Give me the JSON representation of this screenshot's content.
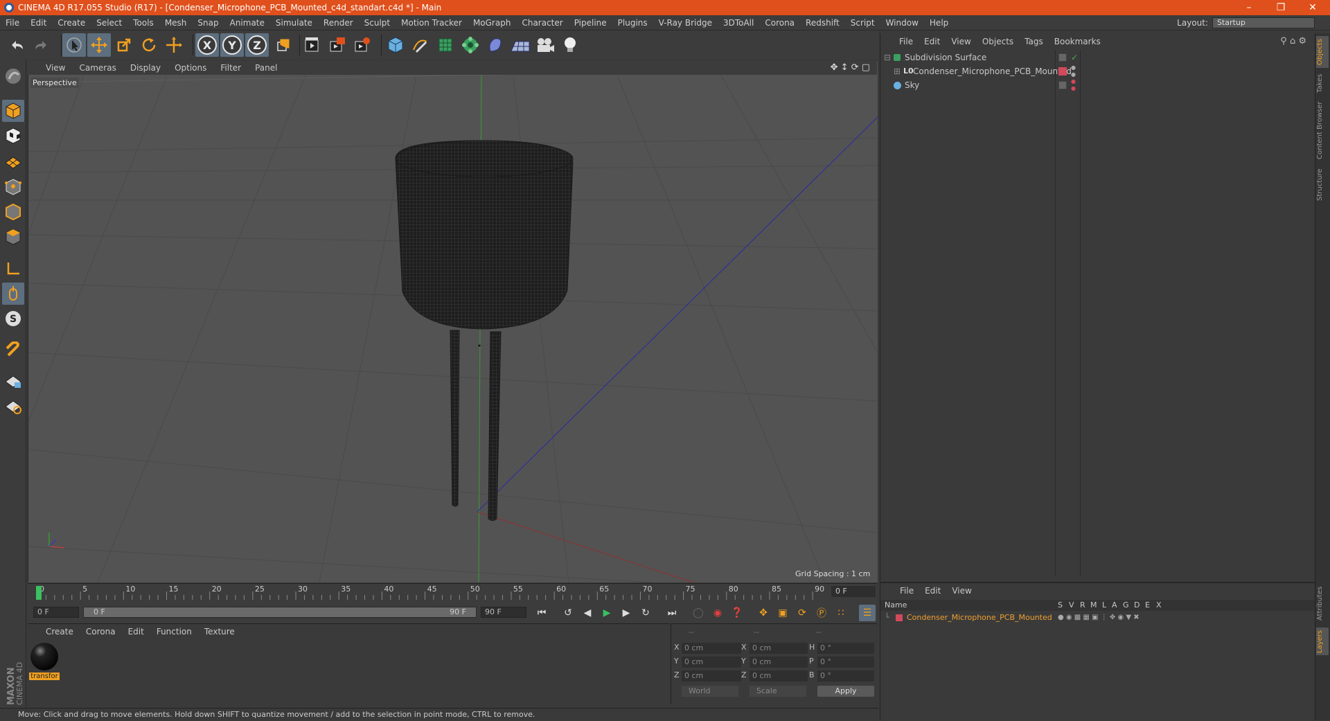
{
  "window": {
    "title": "CINEMA 4D R17.055 Studio (R17) - [Condenser_Microphone_PCB_Mounted_c4d_standart.c4d *] - Main"
  },
  "menubar": {
    "items": [
      "File",
      "Edit",
      "Create",
      "Select",
      "Tools",
      "Mesh",
      "Snap",
      "Animate",
      "Simulate",
      "Render",
      "Sculpt",
      "Motion Tracker",
      "MoGraph",
      "Character",
      "Pipeline",
      "Plugins",
      "V-Ray Bridge",
      "3DToAll",
      "Corona",
      "Redshift",
      "Script",
      "Window",
      "Help"
    ],
    "layout_label": "Layout:",
    "layout_value": "Startup"
  },
  "toolbar": {
    "axis_x": "X",
    "axis_y": "Y",
    "axis_z": "Z"
  },
  "viewport": {
    "menu": [
      "View",
      "Cameras",
      "Display",
      "Options",
      "Filter",
      "Panel"
    ],
    "camera_label": "Perspective",
    "grid_spacing": "Grid Spacing : 1 cm"
  },
  "timeline": {
    "ticks": [
      "0",
      "5",
      "10",
      "15",
      "20",
      "25",
      "30",
      "35",
      "40",
      "45",
      "50",
      "55",
      "60",
      "65",
      "70",
      "75",
      "80",
      "85",
      "90"
    ],
    "current_frame_field": "0 F",
    "start_field": "0 F",
    "range_start": "0 F",
    "range_end": "90 F",
    "end_field": "90 F"
  },
  "material_panel": {
    "menu": [
      "Create",
      "Corona",
      "Edit",
      "Function",
      "Texture"
    ],
    "material_name": "transfor"
  },
  "coords_panel": {
    "headers": [
      "--",
      "--",
      "--"
    ],
    "rows": [
      {
        "a": "X",
        "av": "0 cm",
        "b": "X",
        "bv": "0 cm",
        "c": "H",
        "cv": "0 °"
      },
      {
        "a": "Y",
        "av": "0 cm",
        "b": "Y",
        "bv": "0 cm",
        "c": "P",
        "cv": "0 °"
      },
      {
        "a": "Z",
        "av": "0 cm",
        "b": "Z",
        "bv": "0 cm",
        "c": "B",
        "cv": "0 °"
      }
    ],
    "world": "World",
    "scale": "Scale",
    "apply": "Apply"
  },
  "objects_panel": {
    "menu": [
      "File",
      "Edit",
      "View",
      "Objects",
      "Tags",
      "Bookmarks"
    ],
    "rows": [
      {
        "name": "Subdivision Surface"
      },
      {
        "name": "Condenser_Microphone_PCB_Mounted"
      },
      {
        "name": "Sky"
      }
    ]
  },
  "layers_panel": {
    "menu": [
      "File",
      "Edit",
      "View"
    ],
    "col_name": "Name",
    "cols": [
      "S",
      "V",
      "R",
      "M",
      "L",
      "A",
      "G",
      "D",
      "E",
      "X"
    ],
    "row_name": "Condenser_Microphone_PCB_Mounted"
  },
  "right_tabs": [
    "Objects",
    "Takes",
    "Content Browser",
    "Structure",
    "Attributes",
    "Layers"
  ],
  "status": "Move: Click and drag to move elements. Hold down SHIFT to quantize movement / add to the selection in point mode, CTRL to remove.",
  "brand": "MAXON CINEMA 4D",
  "colors": {
    "accent": "#e0501c",
    "selected_tool": "#5d6e7e",
    "layer_color": "#d1495b",
    "layer_text": "#f0a030"
  }
}
